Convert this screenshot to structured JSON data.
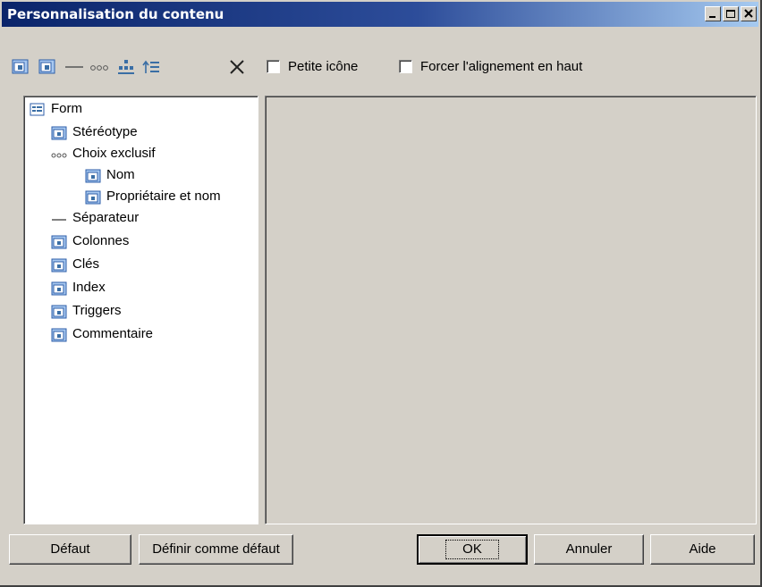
{
  "window": {
    "title": "Personnalisation du contenu"
  },
  "titlebar_buttons": [
    {
      "name": "minimize-icon"
    },
    {
      "name": "maximize-icon"
    },
    {
      "name": "close-icon"
    }
  ],
  "toolbar": {
    "icons": [
      "add-item-icon",
      "add-subitem-icon",
      "separator-line-icon",
      "exclusive-choice-icon",
      "insert-below-icon",
      "move-up-icon",
      "delete-icon"
    ],
    "small_icon_label": "Petite icône",
    "force_align_label": "Forcer l'alignement en haut"
  },
  "tree": {
    "items": [
      {
        "label": "Form",
        "icon": "form-icon",
        "level": 0
      },
      {
        "label": "Stéréotype",
        "icon": "attribute-icon",
        "level": 1
      },
      {
        "label": "Choix exclusif",
        "icon": "exclusive-choice-icon",
        "level": 1
      },
      {
        "label": "Nom",
        "icon": "attribute-icon",
        "level": 2
      },
      {
        "label": "Propriétaire et nom",
        "icon": "attribute-icon",
        "level": 2
      },
      {
        "label": "Séparateur",
        "icon": "separator-icon",
        "level": 1
      },
      {
        "label": "Colonnes",
        "icon": "collection-icon",
        "level": 1
      },
      {
        "label": "Clés",
        "icon": "collection-icon",
        "level": 1
      },
      {
        "label": "Index",
        "icon": "collection-icon",
        "level": 1
      },
      {
        "label": "Triggers",
        "icon": "collection-icon",
        "level": 1
      },
      {
        "label": "Commentaire",
        "icon": "attribute-icon",
        "level": 1
      }
    ]
  },
  "buttons": {
    "default": "Défaut",
    "set_default": "Définir comme défaut",
    "ok": "OK",
    "cancel": "Annuler",
    "help": "Aide"
  },
  "colors": {
    "title_start": "#0a246a",
    "title_end": "#a6caf0",
    "face": "#d4d0c8",
    "icon_blue": "#3a6ea5"
  }
}
